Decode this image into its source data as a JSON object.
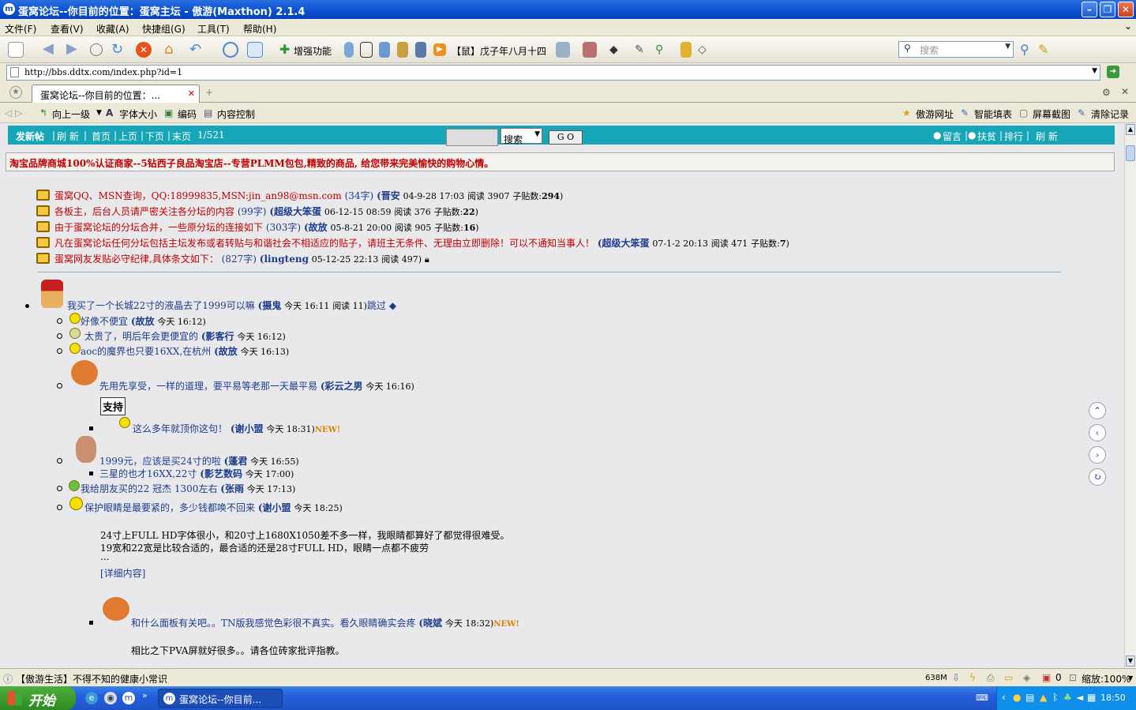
{
  "window": {
    "title": "蛋窝论坛--你目前的位置：蛋窝主坛 - 傲游(Maxthon) 2.1.4"
  },
  "menu": [
    "文件(F)",
    "查看(V)",
    "收藏(A)",
    "快捷组(G)",
    "工具(T)",
    "帮助(H)"
  ],
  "toolbar": {
    "enhance_label": "增强功能",
    "date_label": "【鼠】戊子年八月十四",
    "search_placeholder": "搜索"
  },
  "address": {
    "url": "http://bbs.ddtx.com/index.php?id=1"
  },
  "tabs": [
    {
      "label": "蛋窝论坛--你目前的位置：..."
    }
  ],
  "linkbar": {
    "up": "向上一级",
    "font_size": "字体大小",
    "encoding": "编码",
    "content_control": "内容控制",
    "maxthon_site": "傲游网址",
    "smart_fill": "智能填表",
    "screenshot": "屏幕截图",
    "clear_history": "清除记录"
  },
  "forum_bar": {
    "post": "发新帖",
    "refresh": "刷 新",
    "first": "首页",
    "prev": "上页",
    "next": "下页",
    "last": "末页",
    "page": "1/521",
    "search_select": "搜索",
    "go": "G O",
    "msg": "留言",
    "poverty": "扶贫",
    "rank": "排行",
    "refresh2": "刷 新"
  },
  "ad_text": "淘宝品牌商城100%认证商家--5钻西子良品淘宝店--专营PLMM包包,精致的商品, 给您带来完美愉快的购物心情。",
  "announcements": [
    {
      "title": "蛋窝QQ、MSN查询，QQ:18999835,MSN:jin_an98@msn.com",
      "chars": "(34字)",
      "author": "(晋安",
      "date": "04-9-28 17:03",
      "reads": "阅读 3907",
      "replies_label": "子贴数:",
      "replies": "294",
      "close": ")"
    },
    {
      "title": "各板主，后台人员请严密关注各分坛的内容",
      "chars": "(99字)",
      "author": "(超级大笨蛋",
      "date": "06-12-15 08:59",
      "reads": "阅读 376",
      "replies_label": "子贴数:",
      "replies": "22",
      "close": ")"
    },
    {
      "title": "由于蛋窝论坛的分坛合并，一些原分坛的连接如下",
      "chars": "(303字)",
      "author": "(故放",
      "date": "05-8-21 20:00",
      "reads": "阅读 905",
      "replies_label": "子贴数:",
      "replies": "16",
      "close": ")"
    },
    {
      "title": "凡在蛋窝论坛任何分坛包括主坛发布或者转贴与和谐社会不相适应的贴子，请班主无条件、无理由立即删除！可以不通知当事人！",
      "chars": "",
      "author": "(超级大笨蛋",
      "date": "07-1-2 20:13",
      "reads": "阅读 471",
      "replies_label": "子贴数:",
      "replies": "7",
      "close": ")"
    },
    {
      "title": "蛋窝网友发贴必守纪律,具体条文如下：",
      "chars": "(827字)",
      "author": "(lingteng",
      "date": "05-12-25 22:13",
      "reads": "阅读 497)",
      "replies_label": "",
      "replies": "",
      "close": ""
    }
  ],
  "thread": {
    "main": {
      "title": "我买了一个长城22寸的液晶去了1999可以嘛",
      "author": "(摄鬼",
      "time": "今天 16:11",
      "reads": "阅读 11)",
      "jump": "跳过"
    },
    "replies": [
      {
        "title": "好像不便宜",
        "author": "(故放",
        "time": "今天 16:12)"
      },
      {
        "title": "太贵了，明后年会更便宜的",
        "author": "(影客行",
        "time": "今天 16:12)"
      },
      {
        "title": "aoc的魔界也只要16XX,在杭州",
        "author": "(故放",
        "time": "今天 16:13)"
      },
      {
        "title": "先用先享受，一样的道理，要平易等老那一天最平易",
        "author": "(彩云之男",
        "time": "今天 16:16)"
      },
      {
        "title": "这么多年就顶你这句！",
        "author": "(谢小盟",
        "time": "今天 18:31)",
        "sign": "支持",
        "new": "NEW!"
      },
      {
        "title": "1999元，应该是买24寸的啦",
        "author": "(蓬君",
        "time": "今天 16:55)"
      },
      {
        "title": "三星的也才16XX,22寸",
        "author": "(影艺数码",
        "time": "今天 17:00)"
      },
      {
        "title": "我给朋友买的22 冠杰 1300左右",
        "author": "(张雨",
        "time": "今天 17:13)"
      },
      {
        "title": "保护眼睛是最要紧的，多少钱都唤不回来",
        "author": "(谢小盟",
        "time": "今天 18:25)"
      },
      {
        "title": "和什么面板有关吧。。TN版我感觉色彩很不真实。看久眼睛确实会疼",
        "author": "(晓斌",
        "time": "今天 18:32)",
        "new": "NEW!"
      }
    ],
    "body": [
      "24寸上FULL HD字体很小，和20寸上1680X1050差不多一样，我眼睛都算好了都觉得很难受。",
      "19宽和22宽是比较合适的，最合适的还是28寸FULL HD，眼睛一点都不疲劳",
      "...",
      "[详细内容]"
    ],
    "last_body": "相比之下PVA屏就好很多。。请各位砖家批评指教。"
  },
  "status": {
    "text": "【傲游生活】不得不知的健康小常识",
    "memory": "638M",
    "count": "0",
    "zoom": "缩放:100%"
  },
  "taskbar": {
    "start": "开始",
    "item": "蛋窝论坛--你目前...",
    "clock": "18:50"
  }
}
